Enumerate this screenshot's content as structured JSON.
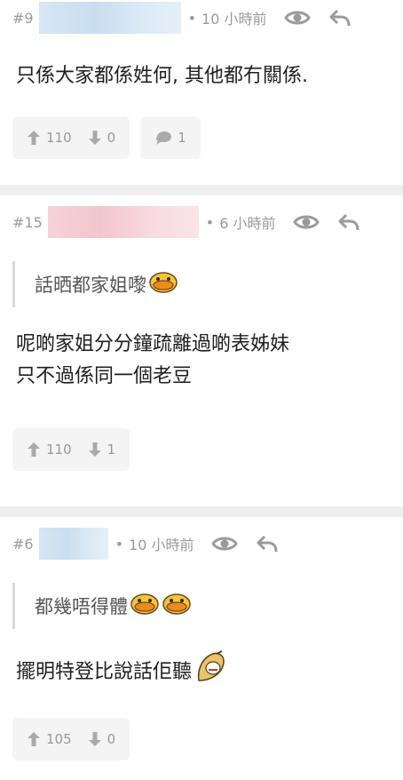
{
  "posts": [
    {
      "floor": "#9",
      "time": "10 小時前",
      "quote": null,
      "lines": [
        "只係大家都係姓何, 其他都冇關係."
      ],
      "upvotes": "110",
      "downvotes": "0",
      "replies": "1"
    },
    {
      "floor": "#15",
      "time": "6 小時前",
      "quote": "話晒都家姐嚟",
      "lines": [
        "呢啲家姐分分鐘疏離過啲表姊妹",
        "只不過係同一個老豆"
      ],
      "upvotes": "110",
      "downvotes": "1"
    },
    {
      "floor": "#6",
      "time": "10 小時前",
      "quote": "都幾唔得體",
      "lines": [
        "擺明特登比說話佢聽"
      ],
      "upvotes": "105",
      "downvotes": "0"
    }
  ],
  "icons": {
    "eye": "eye-icon",
    "reply": "reply-arrow-icon",
    "up": "thumb-up-arrow-icon",
    "down": "thumb-down-arrow-icon",
    "comment": "comment-bubble-icon",
    "emoji_duck": "duck-emoji-icon",
    "emoji_banana": "banana-emoji-icon"
  },
  "colors": {
    "meta_gray": "#9a9a9a",
    "pill_bg": "#f4f4f4",
    "separator": "#eeeeee"
  }
}
